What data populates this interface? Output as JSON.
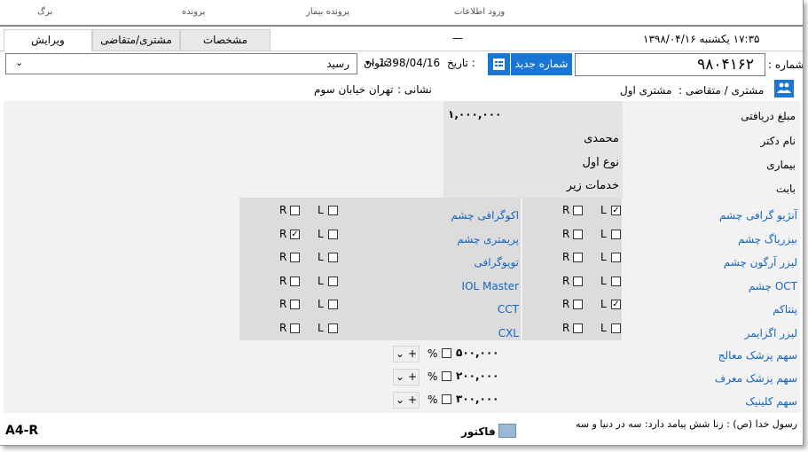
{
  "top_tabs": [
    "برگ",
    "پرونده",
    "پرونده بیمار",
    "ورود اطلاعات"
  ],
  "tabs": [
    {
      "label": "ویرایش",
      "active": true
    },
    {
      "label": "مشتری/متقاضی",
      "active": false
    },
    {
      "label": "مشخصات",
      "active": false
    }
  ],
  "header": {
    "dash": "—",
    "datetime": "۱۷:۳۵   یکشنبه ۱۳۹۸/۰۴/۱۶"
  },
  "form": {
    "number_label": "شماره :",
    "number_value": "۹۸۰۴۱۶۲",
    "new_number_button": "شماره جدید",
    "date_label": "تاریخ :",
    "date_value": "1398/04/16",
    "title_label": "عنوان :",
    "title_value": "رسید",
    "customer_label": "مشتری / متقاضی :",
    "customer_value": "مشتری اول",
    "address_label": "نشانی :",
    "address_value": "تهران خیابان سوم"
  },
  "details": {
    "amount_label": "مبلغ دریافتی",
    "amount_value": "۱,۰۰۰,۰۰۰",
    "doctor_label": "نام دکتر",
    "doctor_value": "محمدی",
    "illness_label": "بیماری",
    "illness_value": "نوع اول",
    "for_label": "بابت",
    "for_value": "خدمات زیر"
  },
  "services_right": [
    {
      "name": "آنژیو گرافی چشم",
      "L": true,
      "R": false
    },
    {
      "name": "بیزریاگ چشم",
      "L": false,
      "R": false
    },
    {
      "name": "لیزر آرگون چشم",
      "L": false,
      "R": false
    },
    {
      "name": "OCT چشم",
      "L": false,
      "R": false
    },
    {
      "name": "پنتاکم",
      "L": true,
      "R": false
    },
    {
      "name": "لیزر اگزایمر",
      "L": false,
      "R": false
    }
  ],
  "services_left": [
    {
      "name": "اکوگرافی چشم",
      "L": false,
      "R": false
    },
    {
      "name": "پریمتری چشم",
      "L": false,
      "R": true
    },
    {
      "name": "توپوگرافی",
      "L": false,
      "R": false
    },
    {
      "name": "IOL Master",
      "L": false,
      "R": false
    },
    {
      "name": "CCT",
      "L": false,
      "R": false
    },
    {
      "name": "CXL",
      "L": false,
      "R": false
    }
  ],
  "shares": [
    {
      "label": "سهم پزشک معالج",
      "value": "۵۰۰,۰۰۰",
      "unit": "%"
    },
    {
      "label": "سهم پزشک معرف",
      "value": "۲۰۰,۰۰۰",
      "unit": "%"
    },
    {
      "label": "سهم کلینیک",
      "value": "۳۰۰,۰۰۰",
      "unit": "%"
    }
  ],
  "footer": {
    "left_text": "A4-R",
    "middle_text": "فاکتور",
    "quote": "رسول خدا (ص) : زنا شش پیامد دارد: سه در دنیا و سه"
  },
  "colors": {
    "accent": "#1976d2",
    "link": "#1565c0",
    "panel": "#dcdcdc"
  },
  "icons": {
    "calendar_grid": "calendar-grid-icon",
    "customer": "people-icon",
    "dropdown": "chevron-down-icon"
  }
}
